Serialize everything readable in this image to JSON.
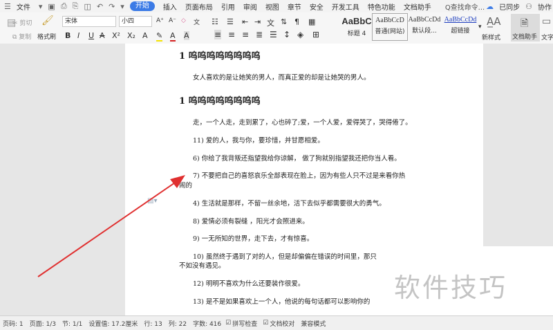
{
  "menubar": {
    "file": "文件",
    "start": "开始",
    "items": [
      "插入",
      "页面布局",
      "引用",
      "审阅",
      "视图",
      "章节",
      "安全",
      "开发工具",
      "特色功能",
      "文档助手"
    ],
    "search": "Q查找命令...",
    "sync": "已同步",
    "collab": "协作"
  },
  "ribbon": {
    "cut": "剪切",
    "copy": "复制",
    "format_painter": "格式刷",
    "font_name": "宋体",
    "font_size": "小四",
    "styles": [
      {
        "sample": "AaBbC",
        "label": "标题 4"
      },
      {
        "sample": "AaBbCcD",
        "label": "普通(网站)"
      },
      {
        "sample": "AaBbCcDd",
        "label": "默认段..."
      },
      {
        "sample": "AaBbCcDd",
        "label": "超链接"
      }
    ],
    "new_style": "新样式",
    "doc_assistant": "文档助手",
    "text_tool": "文字"
  },
  "document": {
    "heading1": "1 呜呜呜呜呜呜呜呜",
    "para1": "女人喜欢的是让她笑的男人，而真正爱的却是让她哭的男人。",
    "heading2": "1 呜呜呜呜呜呜呜呜",
    "para2": "走，一个人走，走到累了，心也碎了;爱，一个人爱，爱得哭了，哭得倦了。",
    "para3": "11)  爱的人，我与你，要珍惜，并甘愿相爱。",
    "para4": "6)  你给了我背叛还指望我给你谅解，  做了狗就别指望我还把你当人看。",
    "para5_line1": "7)  不要把自己的喜怒哀乐全部表现在脸上，因为有些人只不过是来看你热",
    "para5_line2": "闹的",
    "para6": "4)  生活就是那样，不留一丝余地，活下去似乎都需要很大的勇气。",
    "para7": "8)  爱情必须有裂缝 ，阳光才会照进来。",
    "para8": "9)  一无所知的世界，走下去，才有惊喜。",
    "para9_line1": "10)  虽然终于遇到了对的人，但是却偏偏在错误的时间里，那只",
    "para9_line2": "不如没有遇见。",
    "para10": "12)  明明不喜欢为什么还要装作很爱。",
    "para11": "13)  是不是如果喜欢上一个人，他说的每句话都可以影响你的"
  },
  "watermark": "软件技巧",
  "statusbar": {
    "page_no": "页码: 1",
    "page": "页面: 1/3",
    "section": "节: 1/1",
    "position": "设置值: 17.2厘米",
    "row": "行: 13",
    "col": "列: 22",
    "words": "字数: 416",
    "spellcheck": "拼写检查",
    "proofread": "文档校对",
    "compat": "兼容模式"
  },
  "colors": {
    "accent": "#3c7be6",
    "arrow": "#e03030"
  }
}
